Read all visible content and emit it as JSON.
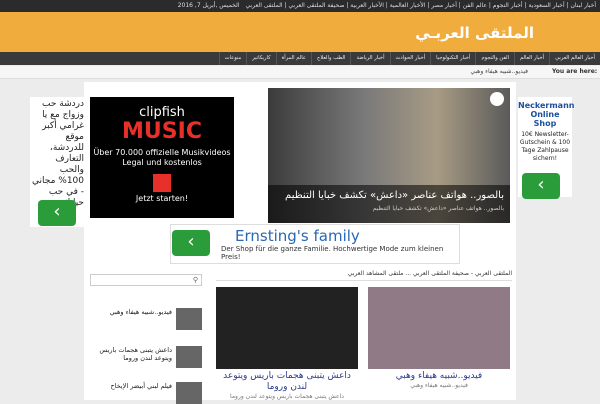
{
  "topbar": {
    "date": "الخميس ,أبريل 7, 2016",
    "links": "أخبار لبنان | أخبار السعودية | أخبار النجوم | عالم الفن | أخبار مصر | الأخبار العالمية | الأخبار العربية | صحيفة الملتقى العربي | الملتقى العربي"
  },
  "site": {
    "title": "الملتقى العربـي"
  },
  "nav": [
    "أخبار العالم العربي",
    "أخبار العالم",
    "الفن والنجوم",
    "أخبار التكنولوجيا",
    "أخبار الحوادث",
    "أخبار الرياضة",
    "الطب والعلاج",
    "عالم المرأة",
    "كاريكاتير",
    "منوعات"
  ],
  "crumb": {
    "label": "You are here:",
    "text": "فيديو..شبيه هيفاء وهبي"
  },
  "ad_left": {
    "text": "دردشة حب وزواج مع يا غرامي أكبر موقع للدردشة، التعارف والحب 100% مجاني - في حب حياتك"
  },
  "ad_right": {
    "brand": "Neckermann Online Shop",
    "text": "10€ Newsletter-Gutschein & 100 Tage Zahlpause sichern!"
  },
  "clipfish": {
    "logo": "clipfish",
    "music": "MUSIC",
    "line": "Über 70.000 offizielle Musikvideos Legal und kostenlos",
    "cta": "Jetzt starten!"
  },
  "slider": {
    "title": "بالصور.. هواتف عناصر «داعش» تكشف خبايا التنظيم",
    "subtitle": "بالصور.. هواتف عناصر «داعش» تكشف خبايا التنظيم"
  },
  "ernsting": {
    "title": "Ernsting's family",
    "subtitle": "Der Shop für die ganze Familie. Hochwertige Mode zum kleinen Preis!"
  },
  "sidebar": {
    "search_placeholder": "",
    "items": [
      "فيديو..شبيه هيفاء وهبي",
      "داعش يتبنى هجمات باريس ويتوعد لندن وروما",
      "فيلم لبني أبيضر الإبخاح"
    ]
  },
  "section": {
    "title": "الملتقى العربي - صحيفة الملتقى العربي ... ملتقى المشاهد العربي"
  },
  "cards": [
    {
      "title": "داعش يتبنى هجمات باريس ويتوعد لندن وروما",
      "sub": "داعش يتبنى هجمات باريس ويتوعد لندن وروما"
    },
    {
      "title": "فيديو..شبيه هيفاء وهبي",
      "sub": "فيديو..شبيه هيفاء وهبي"
    }
  ],
  "colors": {
    "header": "#f0ad3e",
    "nav": "#3a3a3a",
    "accent_green": "#2a9d3a"
  }
}
